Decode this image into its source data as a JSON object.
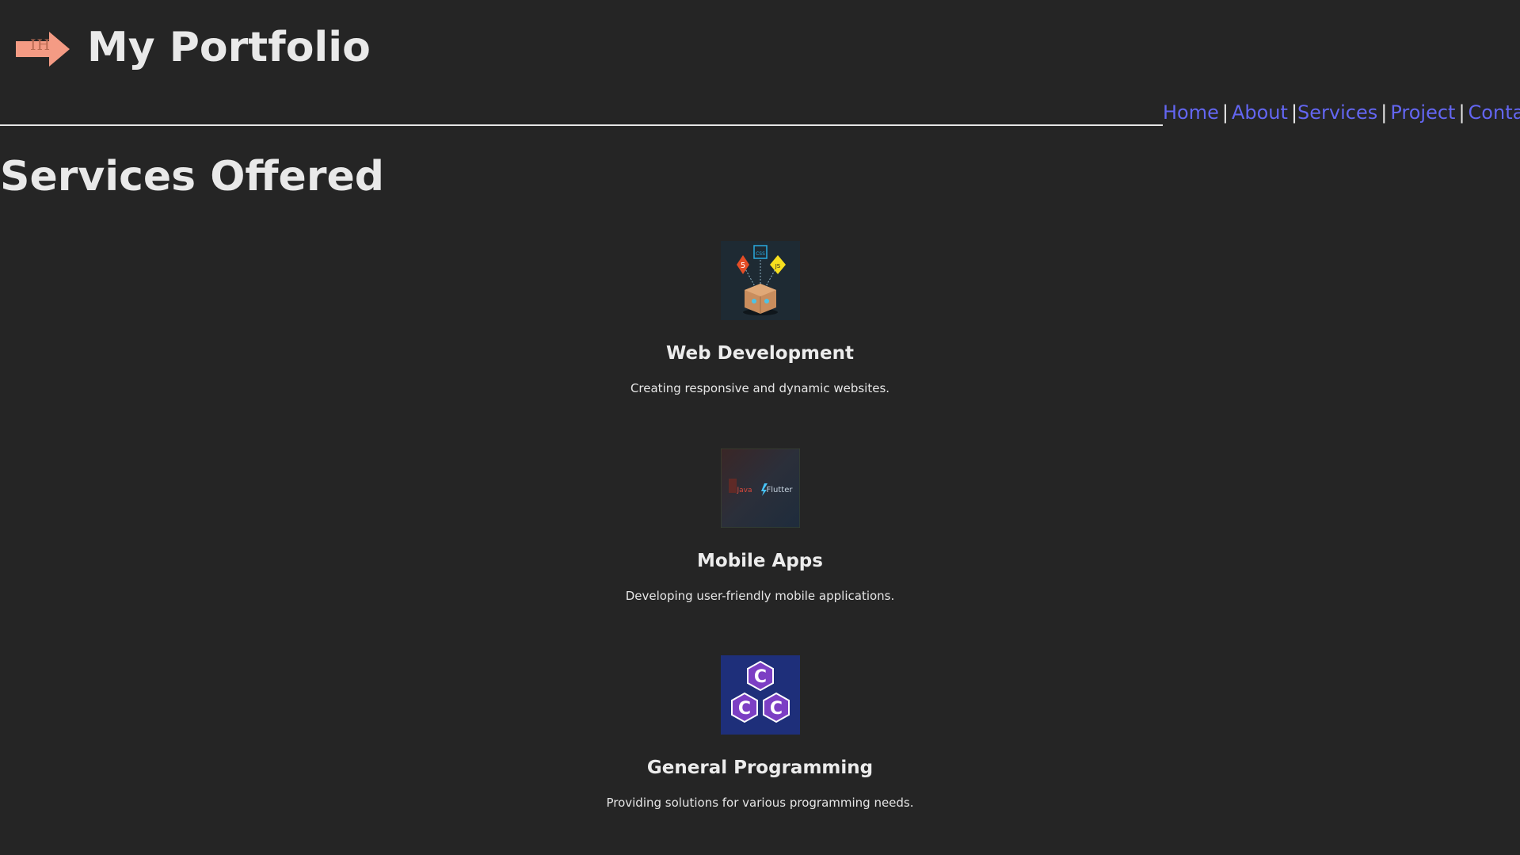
{
  "header": {
    "logo_text": "IH",
    "title": "My Portfolio"
  },
  "nav": {
    "items": [
      {
        "label": "Home"
      },
      {
        "label": "About"
      },
      {
        "label": "Services"
      },
      {
        "label": "Project"
      },
      {
        "label": "Contact"
      }
    ],
    "separator": "|"
  },
  "section": {
    "title": "Services Offered"
  },
  "services": [
    {
      "title": "Web Development",
      "description": "Creating responsive and dynamic websites.",
      "icon": "web-dev-box-icon"
    },
    {
      "title": "Mobile Apps",
      "description": "Developing user-friendly mobile applications.",
      "icon": "java-flutter-icon",
      "image_text": [
        "Java",
        "Flutter"
      ]
    },
    {
      "title": "General Programming",
      "description": "Providing solutions for various programming needs.",
      "icon": "c-languages-icon",
      "image_text": [
        "C",
        "C",
        "C"
      ]
    }
  ],
  "colors": {
    "background": "#252525",
    "text": "#e6e6e6",
    "link": "#6366f1",
    "logo_arrow": "#f49b84"
  }
}
